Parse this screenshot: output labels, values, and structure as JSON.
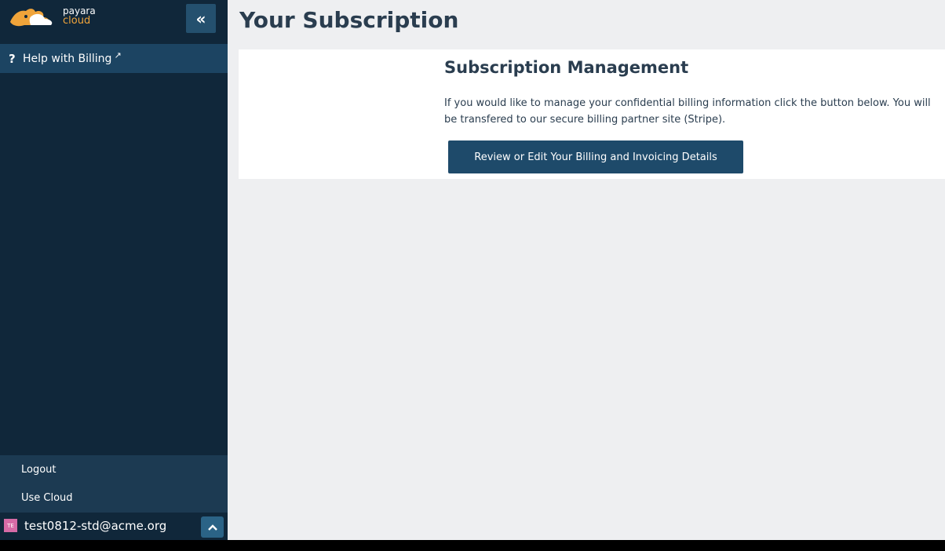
{
  "brand": {
    "name_line1": "payara",
    "name_line2": "cloud"
  },
  "sidebar": {
    "collapse_label": "«",
    "help_item": {
      "icon": "?",
      "label": "Help with Billing",
      "external_icon": "↗"
    },
    "bottom_links": {
      "logout": "Logout",
      "use_cloud": "Use Cloud"
    },
    "user": {
      "avatar_initials": "TE",
      "email": "test0812-std@acme.org",
      "toggle_icon": "chevron-up-icon"
    }
  },
  "main": {
    "page_title": "Your Subscription",
    "card": {
      "title": "Subscription Management",
      "description": "If you would like to manage your confidential billing information click the button below. You will be transfered to our secure billing partner site (Stripe).",
      "button_label": "Review or Edit Your Billing and Invoicing Details"
    }
  },
  "colors": {
    "sidebar_bg": "#10273a",
    "active_item_bg": "#1c4462",
    "button_bg": "#1e4a6a",
    "brand_orange": "#f0a43a",
    "page_bg": "#eeeff1"
  }
}
